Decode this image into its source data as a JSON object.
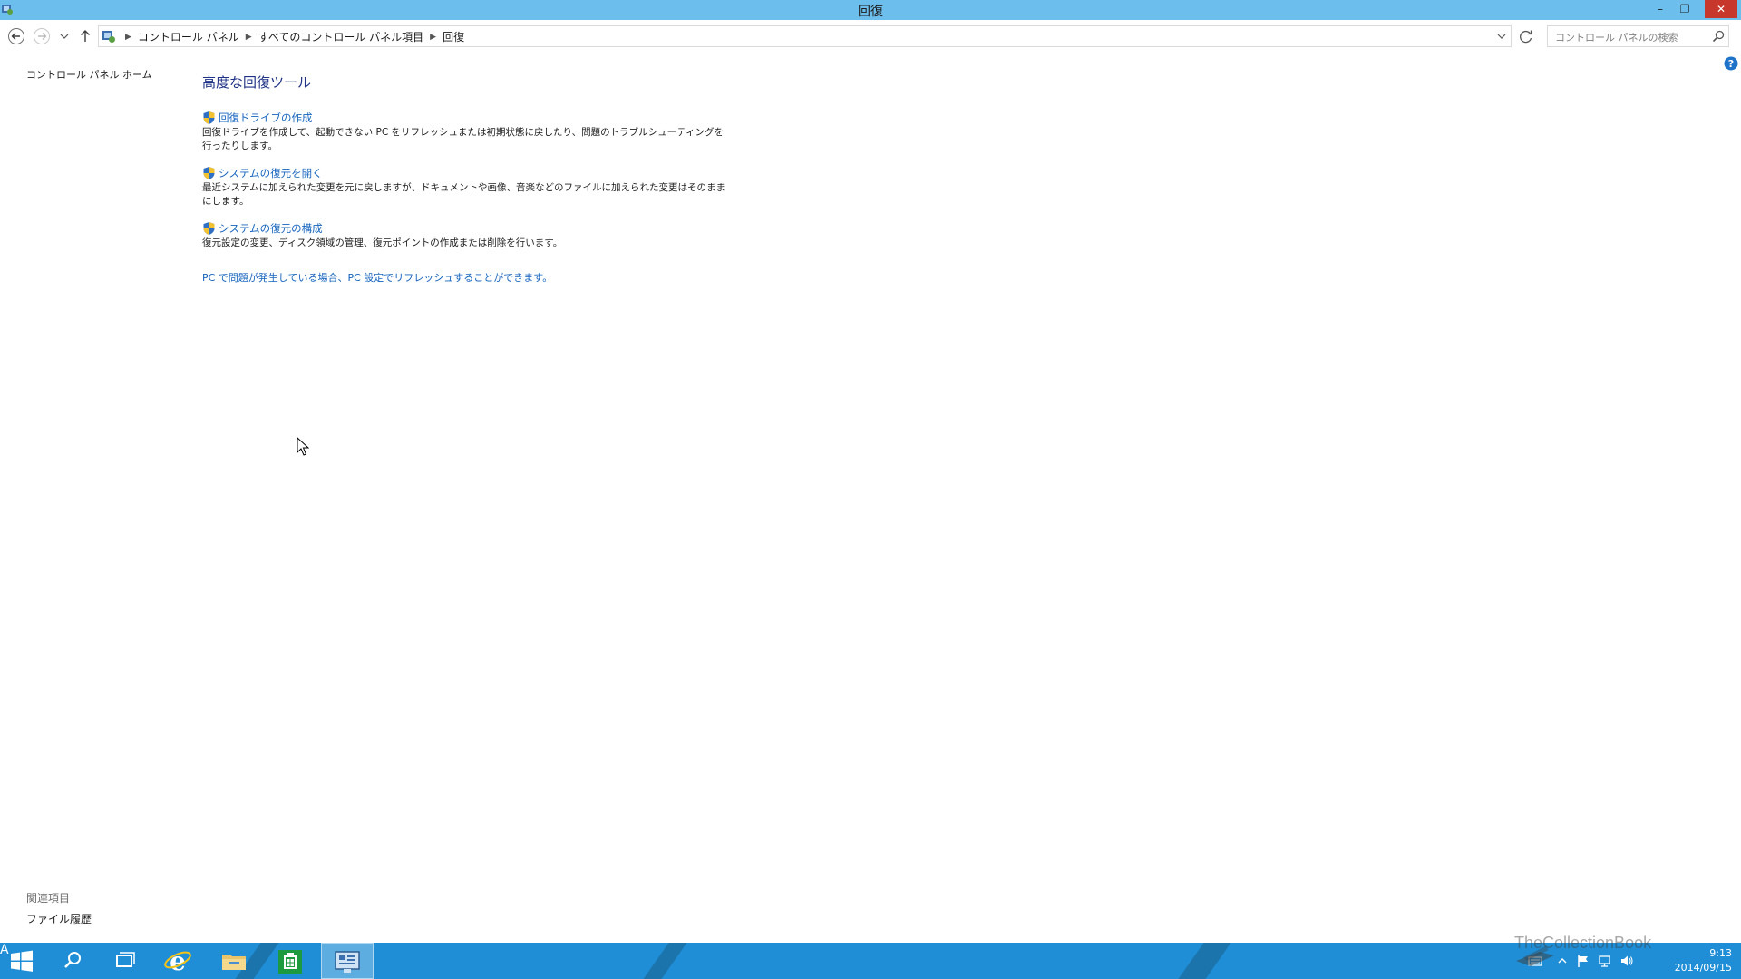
{
  "window": {
    "title": "回復",
    "controls": {
      "minimize": "–",
      "maximize": "❐",
      "close": "✕"
    }
  },
  "address_bar": {
    "breadcrumb": [
      "コントロール パネル",
      "すべてのコントロール パネル項目",
      "回復"
    ],
    "search_placeholder": "コントロール パネルの検索"
  },
  "left_pane": {
    "home_link": "コントロール パネル ホーム",
    "related_heading": "関連項目",
    "related_links": [
      "ファイル履歴"
    ]
  },
  "main": {
    "title": "高度な回復ツール",
    "items": [
      {
        "link": "回復ドライブの作成",
        "desc": "回復ドライブを作成して、起動できない PC をリフレッシュまたは初期状態に戻したり、問題のトラブルシューティングを行ったりします。"
      },
      {
        "link": "システムの復元を開く",
        "desc": "最近システムに加えられた変更を元に戻しますが、ドキュメントや画像、音楽などのファイルに加えられた変更はそのままにします。"
      },
      {
        "link": "システムの復元の構成",
        "desc": "復元設定の変更、ディスク領域の管理、復元ポイントの作成または削除を行います。"
      }
    ],
    "pc_settings_link": "PC で問題が発生している場合、PC 設定でリフレッシュすることができます。"
  },
  "taskbar": {
    "apps": [
      "start",
      "search",
      "task-view",
      "internet-explorer",
      "file-explorer",
      "store",
      "control-panel"
    ],
    "ime": "A",
    "time": "9:13",
    "date": "2014/09/15"
  },
  "watermark": "TheCollectionBook",
  "colors": {
    "titlebar": "#6cbfec",
    "link": "#1564bf",
    "heading": "#1e3287",
    "taskbar": "#1f8ed6",
    "close": "#c7372b"
  }
}
